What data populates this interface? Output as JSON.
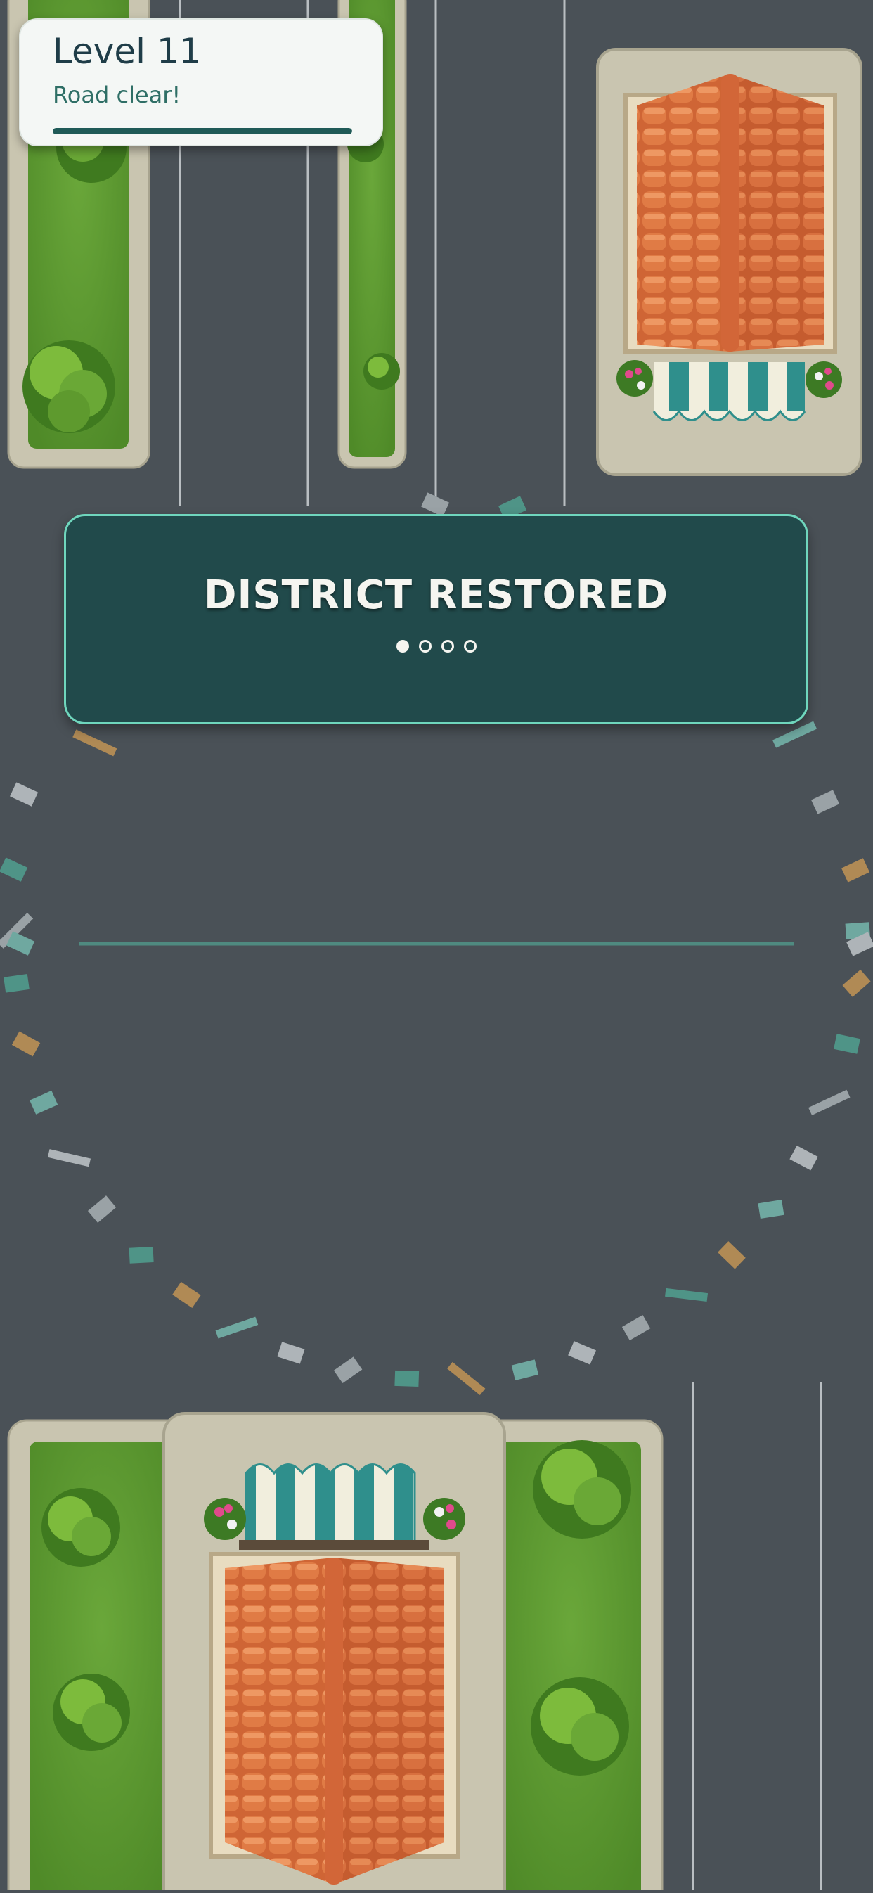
{
  "hud": {
    "level_label": "Level 11",
    "status_text": "Road clear!",
    "progress_fraction": 1.0
  },
  "banner": {
    "title": "DISTRICT RESTORED",
    "page_dots": {
      "count": 4,
      "active_index": 0
    }
  },
  "colors": {
    "asphalt": "#4a5157",
    "banner_bg": "#214a4b",
    "banner_border": "#6fd6bd",
    "grass": "#5d9a2f",
    "roof_tile": "#d9703e",
    "awning_teal": "#2f8f8c",
    "curb": "#c9c5b0"
  },
  "icons": [
    "tree-icon",
    "flower-box-icon",
    "awning-icon",
    "roof-icon"
  ]
}
